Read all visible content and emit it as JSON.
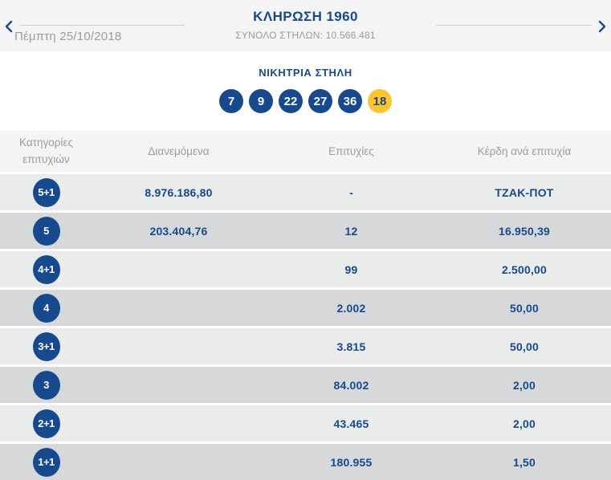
{
  "header": {
    "title": "ΚΛΗΡΩΣΗ 1960",
    "total_columns_label": "ΣΥΝΟΛΟ ΣΤΗΛΩΝ:",
    "total_columns_value": "10.566.481",
    "date": "Πέμπτη 25/10/2018"
  },
  "icons": {
    "prev_draw": "chevron-left",
    "next_draw": "chevron-right"
  },
  "winning_column": {
    "label": "ΝΙΚΗΤΡΙΑ ΣΤΗΛΗ",
    "numbers": [
      "7",
      "9",
      "22",
      "27",
      "36"
    ],
    "joker_number": "18"
  },
  "results_table": {
    "columns": [
      "Κατηγορίες επιτυχιών",
      "Διανεμόμενα",
      "Επιτυχίες",
      "Κέρδη ανά επιτυχία"
    ],
    "rows": [
      {
        "category": "5+1",
        "distributed": "8.976.186,80",
        "winners": "-",
        "prize": "ΤΖΑΚ-ΠΟΤ"
      },
      {
        "category": "5",
        "distributed": "203.404,76",
        "winners": "12",
        "prize": "16.950,39"
      },
      {
        "category": "4+1",
        "distributed": "",
        "winners": "99",
        "prize": "2.500,00"
      },
      {
        "category": "4",
        "distributed": "",
        "winners": "2.002",
        "prize": "50,00"
      },
      {
        "category": "3+1",
        "distributed": "",
        "winners": "3.815",
        "prize": "50,00"
      },
      {
        "category": "3",
        "distributed": "",
        "winners": "84.002",
        "prize": "2,00"
      },
      {
        "category": "2+1",
        "distributed": "",
        "winners": "43.465",
        "prize": "2,00"
      },
      {
        "category": "1+1",
        "distributed": "",
        "winners": "180.955",
        "prize": "1,50"
      }
    ]
  },
  "colors": {
    "navy": "#17498e",
    "joker_yellow": "#fdc42d",
    "header_strip": "#f4f4f4",
    "row_light": "#eaebeb",
    "row_dark": "#d6d8d9",
    "muted_text": "#9b9b9b",
    "divider": "#cdd1d4"
  }
}
